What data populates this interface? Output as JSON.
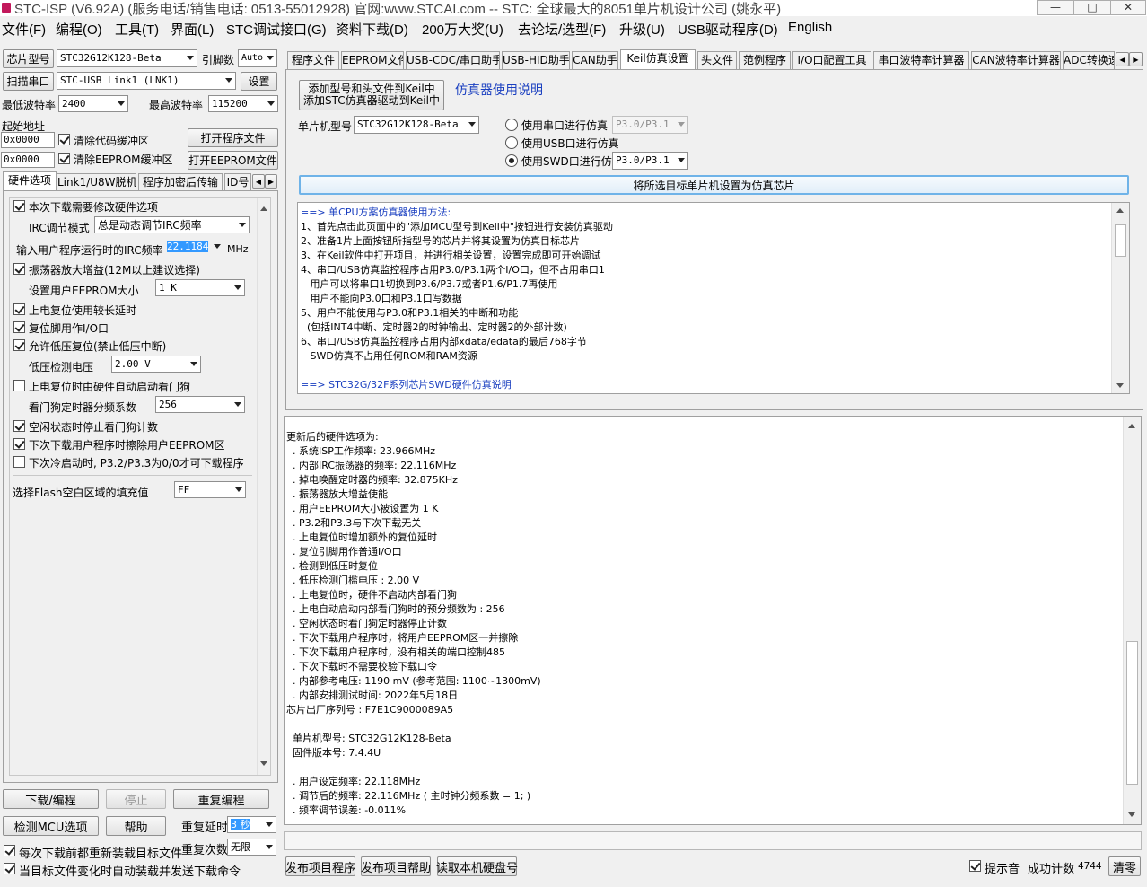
{
  "window": {
    "title": "STC-ISP (V6.92A) (服务电话/销售电话: 0513-55012928) 官网:www.STCAI.com  -- STC: 全球最大的8051单片机设计公司 (姚永平)",
    "minimize": "—",
    "maximize": "□",
    "close": "✕"
  },
  "menu": [
    "文件(F)",
    "编程(O)",
    "工具(T)",
    "界面(L)",
    "STC调试接口(G)",
    "资料下载(D)",
    "200万大奖(U)",
    "去论坛/选型(F)",
    "升级(U)",
    "USB驱动程序(D)",
    "English"
  ],
  "left": {
    "chip_model_btn": "芯片型号",
    "chip_model": "STC32G12K128-Beta",
    "pins_label": "引脚数",
    "pins_value": "Auto",
    "scan_port_btn": "扫描串口",
    "port_value": "STC-USB Link1 (LNK1)",
    "settings_btn": "设置",
    "min_baud_label": "最低波特率",
    "min_baud": "2400",
    "max_baud_label": "最高波特率",
    "max_baud": "115200",
    "start_addr_label": "起始地址",
    "addr1": "0x0000",
    "clear_code_buf": "清除代码缓冲区",
    "open_prog_btn": "打开程序文件",
    "addr2": "0x0000",
    "clear_eeprom_buf": "清除EEPROM缓冲区",
    "open_eeprom_btn": "打开EEPROM文件",
    "tabs": [
      "硬件选项",
      "Link1/U8W脱机",
      "程序加密后传输",
      "ID号"
    ],
    "hw": {
      "opt1": "本次下载需要修改硬件选项",
      "irc_mode_label": "IRC调节模式",
      "irc_mode": "总是动态调节IRC频率",
      "irc_freq_label": "输入用户程序运行时的IRC频率",
      "irc_freq": "22.1184",
      "mhz": "MHz",
      "opt_osc": "振荡器放大增益(12M以上建议选择)",
      "eeprom_size_label": "设置用户EEPROM大小",
      "eeprom_size": "1   K",
      "opt_por": "上电复位使用较长延时",
      "opt_rst": "复位脚用作I/O口",
      "opt_lvr": "允许低压复位(禁止低压中断)",
      "lvd_label": "低压检测电压",
      "lvd": "2.00 V",
      "opt_wdt": "上电复位时由硬件自动启动看门狗",
      "wdt_div_label": "看门狗定时器分频系数",
      "wdt_div": "256",
      "opt_idle": "空闲状态时停止看门狗计数",
      "opt_erase": "下次下载用户程序时擦除用户EEPROM区",
      "opt_cold": "下次冷启动时, P3.2/P3.3为0/0才可下载程序",
      "fill_label": "选择Flash空白区域的填充值",
      "fill": "FF"
    },
    "download_btn": "下载/编程",
    "stop_btn": "停止",
    "reprogram_btn": "重复编程",
    "detect_btn": "检测MCU选项",
    "help_btn": "帮助",
    "repeat_delay_label": "重复延时",
    "repeat_delay": "3 秒",
    "repeat_count_label": "重复次数",
    "repeat_count": "无限",
    "reload_each": "每次下载前都重新装载目标文件",
    "auto_reload": "当目标文件变化时自动装载并发送下载命令"
  },
  "right": {
    "tabs": [
      "程序文件",
      "EEPROM文件",
      "USB-CDC/串口助手",
      "USB-HID助手",
      "CAN助手",
      "Keil仿真设置",
      "头文件",
      "范例程序",
      "I/O口配置工具",
      "串口波特率计算器",
      "CAN波特率计算器",
      "ADC转换速"
    ],
    "add_keil_btn_line1": "添加型号和头文件到Keil中",
    "add_keil_btn_line2": "添加STC仿真器驱动到Keil中",
    "emu_help_link": "仿真器使用说明",
    "mcu_model_label": "单片机型号",
    "mcu_model": "STC32G12K128-Beta",
    "radio_serial": "使用串口进行仿真",
    "radio_serial_port": "P3.0/P3.1",
    "radio_usb": "使用USB口进行仿真",
    "radio_swd": "使用SWD口进行仿真",
    "radio_swd_port": "P3.0/P3.1",
    "set_emu_btn": "将所选目标单片机设置为仿真芯片",
    "notes": [
      "==> 单CPU方案仿真器使用方法:",
      "1、首先点击此页面中的\"添加MCU型号到Keil中\"按钮进行安装仿真驱动",
      "2、准备1片上面按钮所指型号的芯片并将其设置为仿真目标芯片",
      "3、在Keil软件中打开项目，并进行相关设置，设置完成即可开始调试",
      "4、串口/USB仿真监控程序占用P3.0/P3.1两个I/O口，但不占用串口1",
      "   用户可以将串口1切换到P3.6/P3.7或者P1.6/P1.7再使用",
      "   用户不能向P3.0口和P3.1口写数据",
      "5、用户不能使用与P3.0和P3.1相关的中断和功能",
      "  (包括INT4中断、定时器2的时钟输出、定时器2的外部计数)",
      "6、串口/USB仿真监控程序占用内部xdata/edata的最后768字节",
      "   SWD仿真不占用任何ROM和RAM资源",
      "",
      "==> STC32G/32F系列芯片SWD硬件仿真说明"
    ],
    "log": [
      "更新后的硬件选项为:",
      "  . 系统ISP工作频率: 23.966MHz",
      "  . 内部IRC振荡器的频率: 22.116MHz",
      "  . 掉电唤醒定时器的频率: 32.875KHz",
      "  . 振荡器放大增益使能",
      "  . 用户EEPROM大小被设置为 1 K",
      "  . P3.2和P3.3与下次下载无关",
      "  . 上电复位时增加额外的复位延时",
      "  . 复位引脚用作普通I/O口",
      "  . 检测到低压时复位",
      "  . 低压检测门槛电压 : 2.00 V",
      "  . 上电复位时，硬件不启动内部看门狗",
      "  . 上电自动启动内部看门狗时的预分频数为 : 256",
      "  . 空闲状态时看门狗定时器停止计数",
      "  . 下次下载用户程序时，将用户EEPROM区一并擦除",
      "  . 下次下载用户程序时，没有相关的端口控制485",
      "  . 下次下载时不需要校验下载口令",
      "  . 内部参考电压: 1190 mV (参考范围: 1100~1300mV)",
      "  . 内部安排测试时间: 2022年5月18日",
      "芯片出厂序列号 : F7E1C9000089A5",
      "",
      "  单片机型号: STC32G12K128-Beta",
      "  固件版本号: 7.4.4U",
      "",
      "  . 用户设定频率: 22.118MHz",
      "  . 调节后的频率: 22.116MHz ( 主时钟分频系数 = 1; )",
      "  . 频率调节误差: -0.011%"
    ],
    "publish_prog_btn": "发布项目程序",
    "publish_help_btn": "发布项目帮助",
    "read_disk_btn": "读取本机硬盘号",
    "beep_label": "提示音",
    "success_label": "成功计数",
    "success_count": "4744",
    "clear_btn": "清零"
  }
}
